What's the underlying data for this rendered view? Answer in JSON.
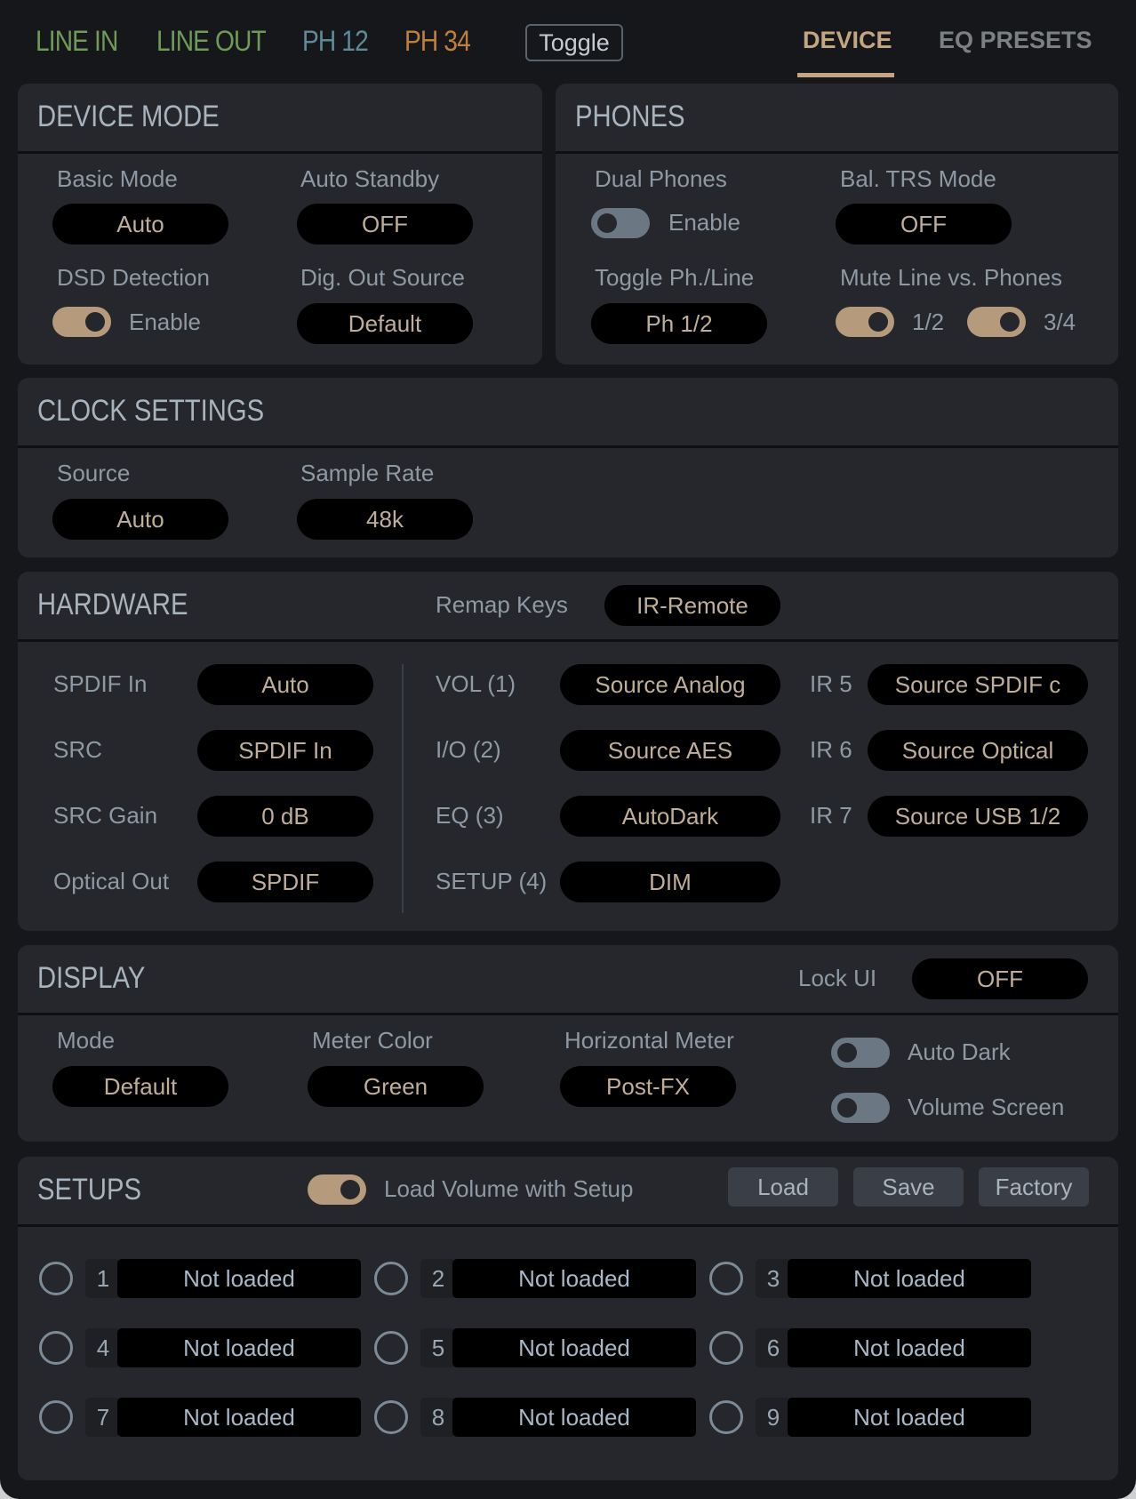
{
  "topbar": {
    "meters": [
      {
        "label": "LINE IN",
        "color": "#6f9a58"
      },
      {
        "label": "LINE OUT",
        "color": "#6f9a58"
      },
      {
        "label": "PH 12",
        "color": "#5f8a96"
      },
      {
        "label": "PH 34",
        "color": "#c07f3c"
      }
    ],
    "toggle_label": "Toggle",
    "tabs": [
      {
        "label": "DEVICE",
        "active": true
      },
      {
        "label": "EQ PRESETS",
        "active": false
      }
    ],
    "accent_color": "#c4a581"
  },
  "device_mode": {
    "title": "DEVICE MODE",
    "basic_mode": {
      "label": "Basic Mode",
      "value": "Auto"
    },
    "auto_standby": {
      "label": "Auto Standby",
      "value": "OFF"
    },
    "dsd_detection": {
      "label": "DSD Detection",
      "switch_label": "Enable",
      "on": true
    },
    "dig_out_source": {
      "label": "Dig. Out Source",
      "value": "Default"
    }
  },
  "phones": {
    "title": "PHONES",
    "dual_phones": {
      "label": "Dual Phones",
      "switch_label": "Enable",
      "on": false
    },
    "bal_trs_mode": {
      "label": "Bal. TRS Mode",
      "value": "OFF"
    },
    "toggle_ph_line": {
      "label": "Toggle Ph./Line",
      "value": "Ph 1/2"
    },
    "mute_line": {
      "label": "Mute Line vs. Phones",
      "switches": [
        {
          "label": "1/2",
          "on": true
        },
        {
          "label": "3/4",
          "on": true
        }
      ]
    }
  },
  "clock": {
    "title": "CLOCK SETTINGS",
    "source": {
      "label": "Source",
      "value": "Auto"
    },
    "sample_rate": {
      "label": "Sample Rate",
      "value": "48k"
    }
  },
  "hardware": {
    "title": "HARDWARE",
    "remap_keys": {
      "label": "Remap Keys",
      "value": "IR-Remote"
    },
    "left": [
      {
        "label": "SPDIF In",
        "value": "Auto"
      },
      {
        "label": "SRC",
        "value": "SPDIF In"
      },
      {
        "label": "SRC Gain",
        "value": "0 dB"
      },
      {
        "label": "Optical Out",
        "value": "SPDIF"
      }
    ],
    "keys": [
      {
        "label": "VOL (1)",
        "value": "Source Analog"
      },
      {
        "label": "I/O (2)",
        "value": "Source AES"
      },
      {
        "label": "EQ (3)",
        "value": "AutoDark"
      },
      {
        "label": "SETUP (4)",
        "value": "DIM"
      }
    ],
    "ir": [
      {
        "label": "IR 5",
        "value": "Source SPDIF c"
      },
      {
        "label": "IR 6",
        "value": "Source Optical"
      },
      {
        "label": "IR 7",
        "value": "Source USB 1/2"
      }
    ]
  },
  "display": {
    "title": "DISPLAY",
    "lock_ui": {
      "label": "Lock UI",
      "value": "OFF"
    },
    "mode": {
      "label": "Mode",
      "value": "Default"
    },
    "meter_color": {
      "label": "Meter Color",
      "value": "Green"
    },
    "horizontal_meter": {
      "label": "Horizontal Meter",
      "value": "Post-FX"
    },
    "auto_dark": {
      "label": "Auto Dark",
      "on": false
    },
    "volume_screen": {
      "label": "Volume Screen",
      "on": false
    }
  },
  "setups": {
    "title": "SETUPS",
    "load_volume": {
      "label": "Load Volume with Setup",
      "on": true
    },
    "buttons": {
      "load": "Load",
      "save": "Save",
      "factory": "Factory"
    },
    "slots": [
      {
        "num": "1",
        "name": "Not loaded"
      },
      {
        "num": "2",
        "name": "Not loaded"
      },
      {
        "num": "3",
        "name": "Not loaded"
      },
      {
        "num": "4",
        "name": "Not loaded"
      },
      {
        "num": "5",
        "name": "Not loaded"
      },
      {
        "num": "6",
        "name": "Not loaded"
      },
      {
        "num": "7",
        "name": "Not loaded"
      },
      {
        "num": "8",
        "name": "Not loaded"
      },
      {
        "num": "9",
        "name": "Not loaded"
      }
    ]
  }
}
